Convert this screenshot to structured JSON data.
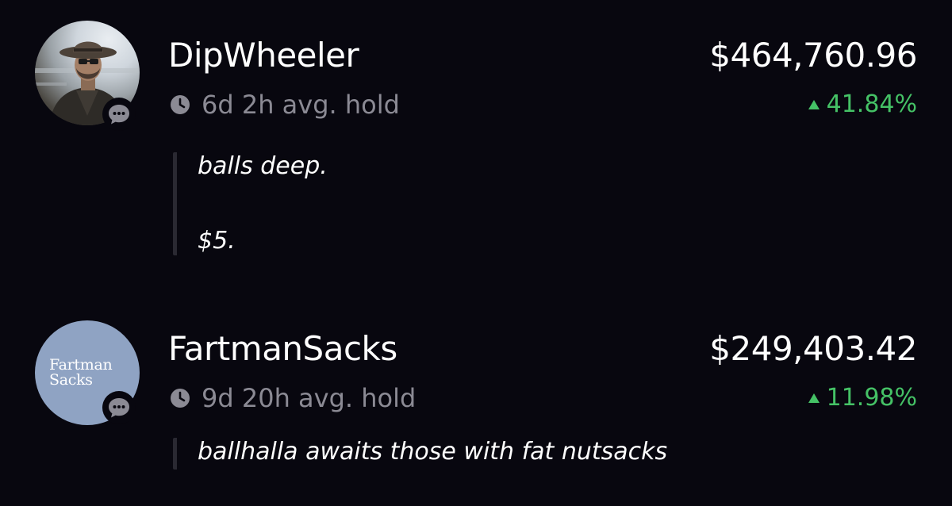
{
  "entries": [
    {
      "username": "DipWheeler",
      "avg_hold": "6d 2h avg. hold",
      "value": "$464,760.96",
      "change": "41.84%",
      "change_direction": "up",
      "avatar": "cowboy-photo",
      "quote_lines": [
        "balls deep.",
        "$5."
      ]
    },
    {
      "username": "FartmanSacks",
      "avg_hold": "9d 20h avg. hold",
      "value": "$249,403.42",
      "change": "11.98%",
      "change_direction": "up",
      "avatar": "fartman-sacks-logo",
      "avatar_logo_lines": [
        "Fartman",
        "Sacks"
      ],
      "quote_lines": [
        "ballhalla awaits those with fat nutsacks"
      ]
    }
  ],
  "colors": {
    "background": "#08070f",
    "positive": "#45c266",
    "muted": "#8b8a94",
    "quote_bar": "#2a2932",
    "logo_bg": "#8fa3c3"
  },
  "icons": [
    "clock-icon",
    "chat-bubble-icon",
    "up-triangle-icon"
  ]
}
